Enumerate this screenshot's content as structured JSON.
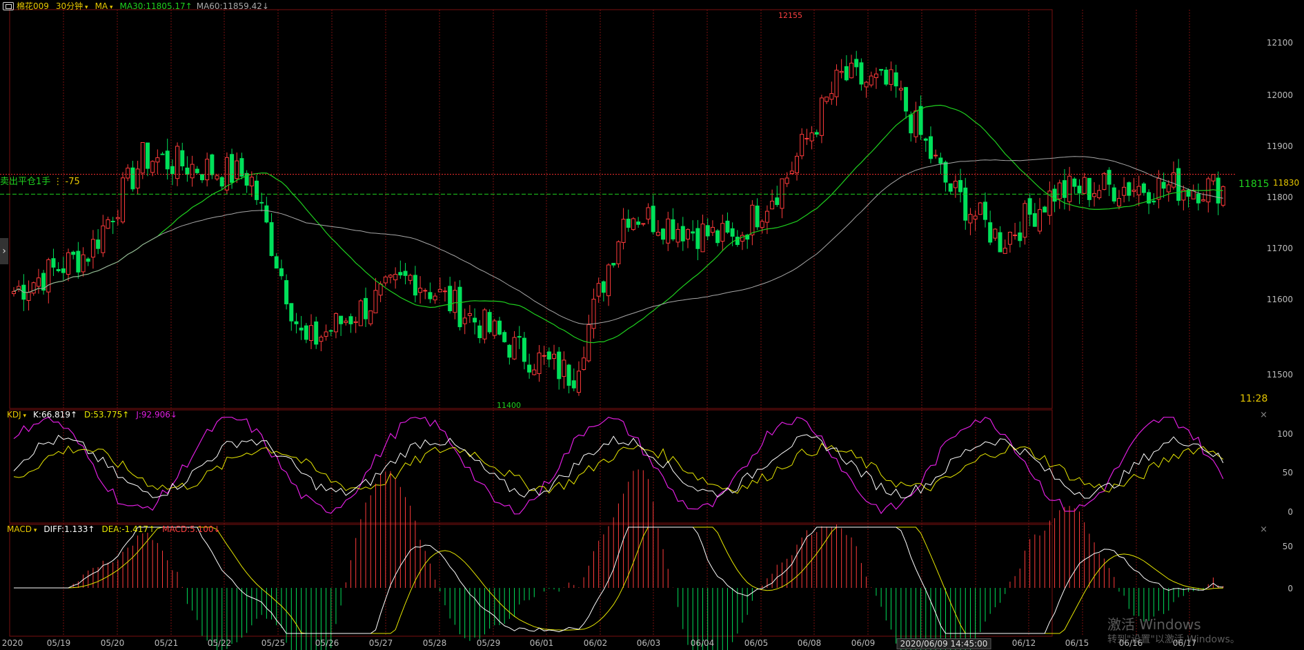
{
  "header": {
    "logo_icon": "window-restore-icon",
    "symbol": "棉花009",
    "period": "30分钟",
    "indicator": "MA",
    "ma30": "MA30:11805.17↑",
    "ma60": "MA60:11859.42↓"
  },
  "main": {
    "position_label": "卖出平仓1手",
    "position_pnl": "-75",
    "high_label": "12155",
    "low_label": "11400",
    "last_price": "11830",
    "line_price": "11815",
    "time": "11:28",
    "y_ticks": [
      "12100",
      "12000",
      "11900",
      "11800",
      "11700",
      "11600",
      "11500"
    ]
  },
  "kdj": {
    "name": "KDJ",
    "k": "K:66.819↑",
    "d": "D:53.775↑",
    "j": "J:92.906↓",
    "y_ticks": [
      "100",
      "50",
      "0"
    ],
    "close": "×"
  },
  "macd": {
    "name": "MACD",
    "diff": "DIFF:1.133↑",
    "dea": "DEA:-1.417↑",
    "macd": "MACD:5.100↓",
    "y_ticks": [
      "50",
      "0"
    ],
    "close": "×"
  },
  "xaxis": {
    "labels": [
      "2020",
      "05/19",
      "05/20",
      "05/21",
      "05/22",
      "05/25",
      "05/26",
      "05/27",
      "05/28",
      "05/29",
      "06/01",
      "06/02",
      "06/03",
      "06/04",
      "06/05",
      "06/08",
      "06/09",
      "06/12",
      "06/15",
      "06/16",
      "06/17"
    ],
    "cursor_time": "2020/06/09 14:45:00"
  },
  "watermark": {
    "line1": "激活 Windows",
    "line2": "转到\"设置\"以激活 Windows。"
  },
  "colors": {
    "up": "#ff3b3b",
    "down": "#00e05a",
    "ma30": "#1fd11f",
    "ma60": "#a8a8a8",
    "k": "#ffffff",
    "d": "#e8e800",
    "j": "#e01ee0",
    "label_yellow": "#e8c800",
    "grid": "#7a1010"
  },
  "chart_data": {
    "type": "candlestick",
    "anchors": [
      {
        "date": "05/19",
        "close": 11700
      },
      {
        "date": "05/20",
        "high": 11960,
        "close": 11890
      },
      {
        "date": "05/22",
        "close": 11850
      },
      {
        "date": "05/25",
        "low": 11460,
        "close": 11510
      },
      {
        "date": "05/27",
        "close": 11650
      },
      {
        "date": "05/29",
        "close": 11500
      },
      {
        "date": "06/01",
        "low": 11400,
        "close": 11450
      },
      {
        "date": "06/02",
        "close": 11780
      },
      {
        "date": "06/04",
        "close": 11720
      },
      {
        "date": "06/05",
        "close": 11850
      },
      {
        "date": "06/08",
        "high": 12155,
        "close": 12050
      },
      {
        "date": "06/09",
        "close": 12030
      },
      {
        "date": "06/12",
        "close": 11830
      },
      {
        "date": "06/15",
        "close": 11720
      },
      {
        "date": "06/16",
        "close": 11820
      },
      {
        "date": "06/17",
        "close": 11830
      }
    ],
    "ylim": [
      11400,
      12155
    ],
    "last": 11830,
    "ma30_last": 11805.17,
    "ma60_last": 11859.42
  }
}
